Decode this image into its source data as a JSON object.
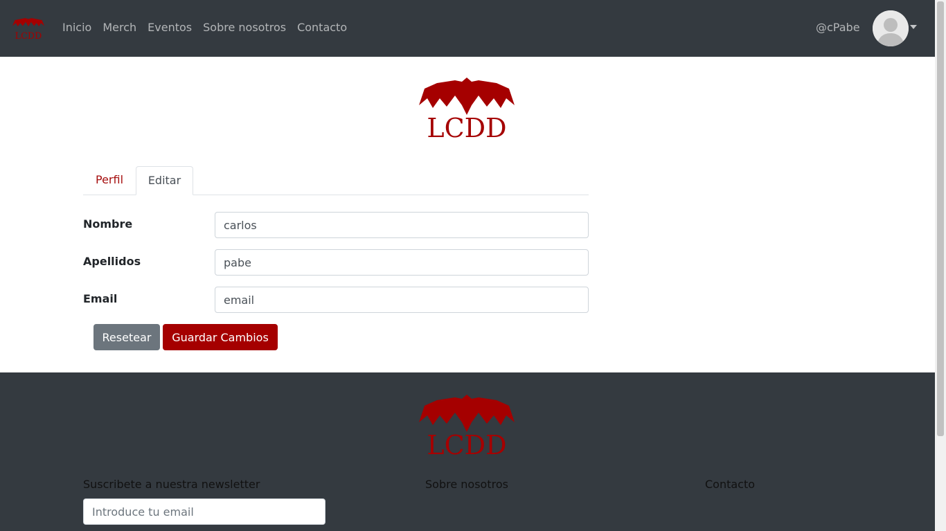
{
  "navbar": {
    "logo_text": "LCDD",
    "links": [
      "Inicio",
      "Merch",
      "Eventos",
      "Sobre nosotros",
      "Contacto"
    ],
    "username": "@cPabe"
  },
  "main": {
    "logo_text": "LCDD",
    "tabs": [
      {
        "label": "Perfil",
        "active": false
      },
      {
        "label": "Editar",
        "active": true
      }
    ],
    "form": {
      "nombre_label": "Nombre",
      "nombre_value": "carlos",
      "apellidos_label": "Apellidos",
      "apellidos_value": "pabe",
      "email_label": "Email",
      "email_value": "email"
    },
    "buttons": {
      "reset_label": "Resetear",
      "save_label": "Guardar Cambios"
    }
  },
  "footer": {
    "logo_text": "LCDD",
    "newsletter_heading": "Suscribete a nuestra newsletter",
    "newsletter_placeholder": "Introduce tu email",
    "about_heading": "Sobre nosotros",
    "contact_heading": "Contacto"
  },
  "colors": {
    "brand_red": "#a50000",
    "navbar_bg": "#343a40",
    "reset_button": "#6c757d"
  }
}
